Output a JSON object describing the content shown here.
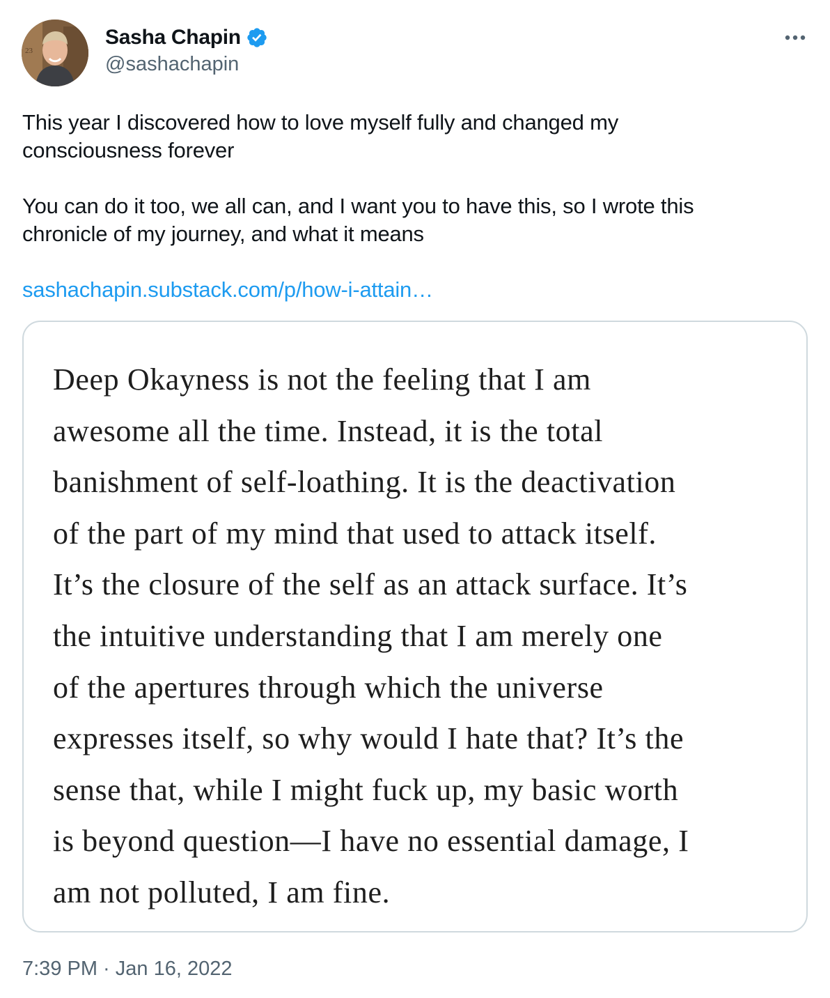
{
  "author": {
    "display_name": "Sasha Chapin",
    "handle": "@sashachapin",
    "verified": true,
    "avatar_icon": "profile-photo"
  },
  "more_icon": "more-options-icon",
  "tweet": {
    "paragraph_1_line_1": "This year I discovered how to love myself fully and changed my",
    "paragraph_1_line_2": "consciousness forever",
    "paragraph_2_line_1": "You can do it too, we all can, and I want you to have this, so I wrote this",
    "paragraph_2_line_2": "chronicle of my journey, and what it means",
    "link_text": "sashachapin.substack.com/p/how-i-attain…"
  },
  "media": {
    "lines": [
      "Deep Okayness is not the feeling that I am",
      "awesome all the time. Instead, it is the total",
      "banishment of self-loathing. It is the deactivation",
      "of the part of my mind that used to attack itself.",
      "It’s the closure of the self as an attack surface. It’s",
      "the intuitive understanding that I am merely one",
      "of the apertures through which the universe",
      "expresses itself, so why would I hate that? It’s the",
      "sense that, while I might fuck up, my basic worth",
      "is beyond question—I have no essential damage, I",
      "am not polluted, I am fine."
    ]
  },
  "meta": {
    "time": "7:39 PM",
    "separator": " · ",
    "date": "Jan 16, 2022"
  },
  "colors": {
    "link": "#1d9bf0",
    "secondary_text": "#536471",
    "verified_badge": "#1d9bf0",
    "border": "#cfd9de"
  }
}
